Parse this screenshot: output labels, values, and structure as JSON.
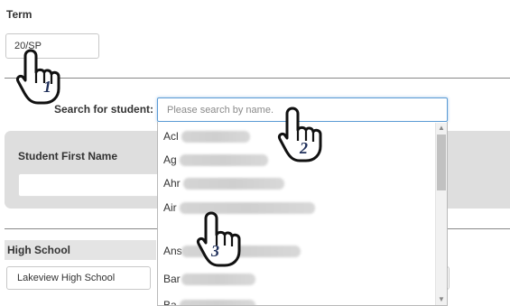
{
  "term": {
    "label": "Term",
    "value": "20/SP"
  },
  "search": {
    "label": "Search for student:",
    "placeholder": "Please search by name."
  },
  "panel": {
    "first_name_label": "Student First Name"
  },
  "high_school": {
    "header": "High School",
    "value": "Lakeview High School"
  },
  "dropdown": {
    "items": [
      {
        "prefix": "Acl"
      },
      {
        "prefix": "Ag"
      },
      {
        "prefix": "Ahr"
      },
      {
        "prefix": "Air"
      },
      {
        "prefix": "Ans"
      },
      {
        "prefix": "Bar"
      },
      {
        "prefix": "Ba"
      }
    ]
  },
  "annotations": {
    "step1": "1",
    "step2": "2",
    "step3": "3"
  },
  "icons": {
    "cursor": "hand-pointer-icon",
    "scroll_up": "triangle-up-icon",
    "scroll_down": "triangle-down-icon"
  }
}
